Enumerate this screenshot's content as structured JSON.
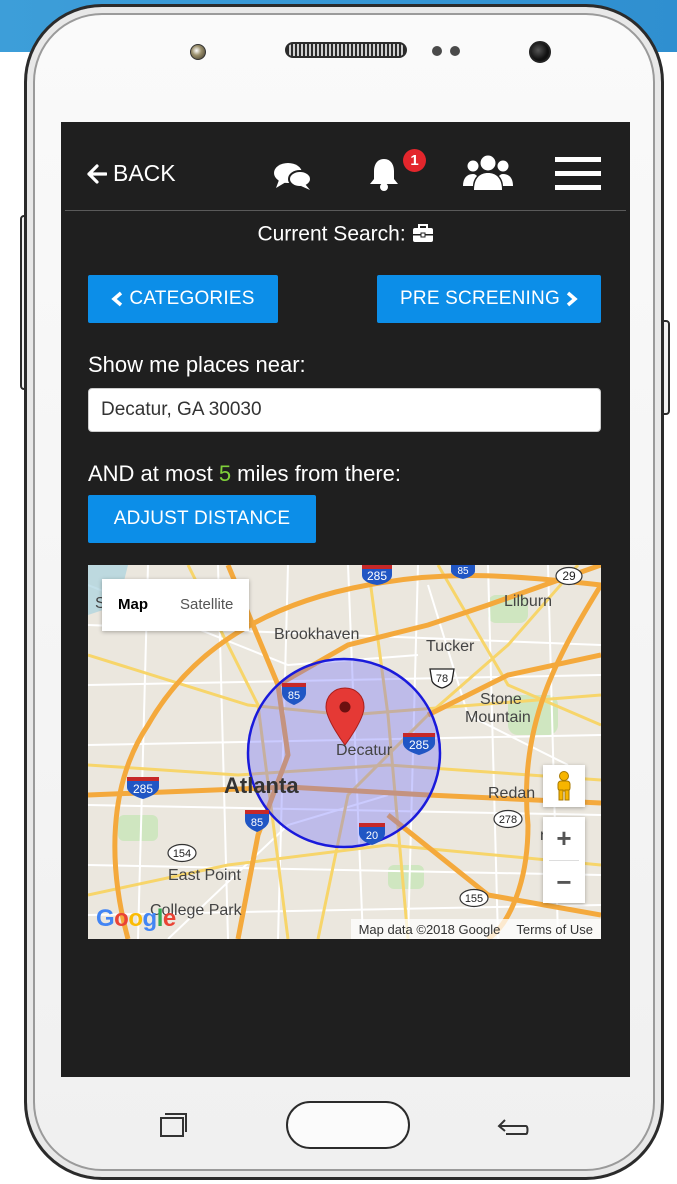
{
  "topbar": {
    "back_label": "BACK",
    "notification_count": "1",
    "icons": [
      "arrow-left-icon",
      "chat-icon",
      "bell-icon",
      "users-icon",
      "hamburger-menu-icon"
    ]
  },
  "search": {
    "current_label": "Current Search:",
    "icon": "briefcase-icon"
  },
  "buttons": {
    "categories": "CATEGORIES",
    "pre_screening": "PRE SCREENING",
    "adjust_distance": "ADJUST DISTANCE"
  },
  "location": {
    "prompt": "Show me places near:",
    "value": "Decatur, GA 30030"
  },
  "distance": {
    "prefix": "AND at most ",
    "miles": "5",
    "suffix": " miles from there:"
  },
  "map": {
    "type_map": "Map",
    "type_satellite": "Satellite",
    "zoom_in": "+",
    "zoom_out": "−",
    "attribution": "Map data ©2018 Google",
    "terms": "Terms of Use",
    "logo": "Google",
    "labels": {
      "lilburn": "Lilburn",
      "brookhaven": "Brookhaven",
      "tucker": "Tucker",
      "stone_mountain_1": "Stone",
      "stone_mountain_2": "Mountain",
      "decatur": "Decatur",
      "atlanta": "Atlanta",
      "redan": "Redan",
      "east_point": "East Point",
      "college_park": "College Park",
      "lithonia_partial": "nia",
      "s_partial": "S"
    },
    "shields": {
      "i285_top": "285",
      "i85_top": "85",
      "r29": "29",
      "us78": "78",
      "i85_mid": "85",
      "i285_right": "285",
      "i285_left": "285",
      "i85_low": "85",
      "i20": "20",
      "r278": "278",
      "r154": "154",
      "r155": "155"
    }
  },
  "colors": {
    "screen_bg": "#1f1f1f",
    "button": "#0c8ee8",
    "miles_highlight": "#7fd03a",
    "badge": "#e3262c",
    "radius_circle": "#1a1adb"
  }
}
